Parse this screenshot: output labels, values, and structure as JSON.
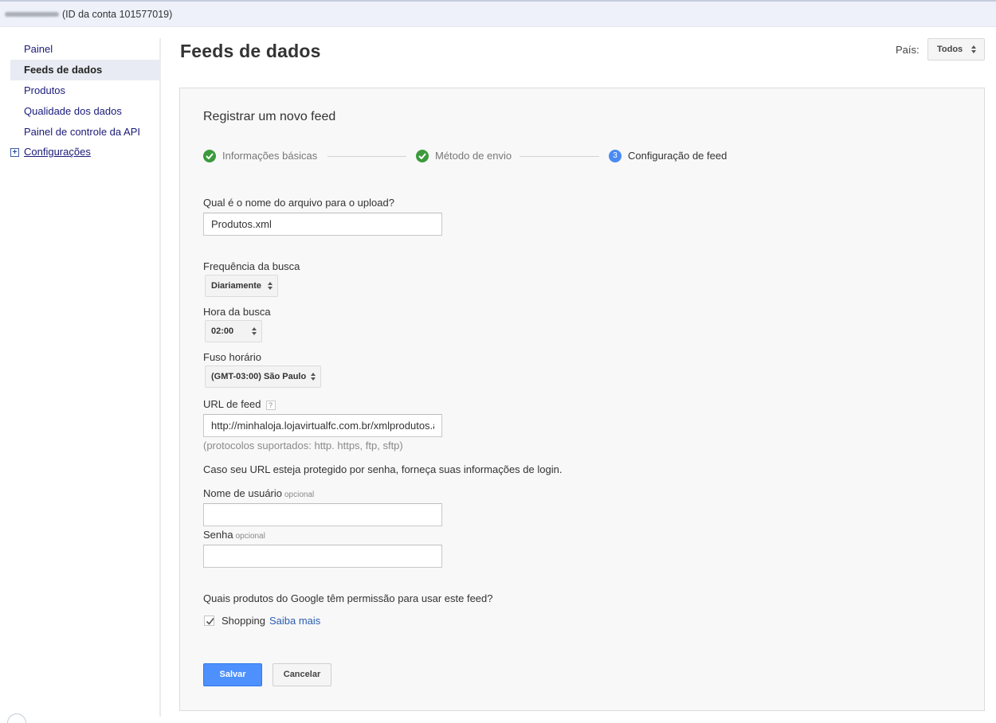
{
  "topbar": {
    "account_id_text": "(ID da conta 101577019)"
  },
  "sidebar": {
    "items": [
      {
        "label": "Painel"
      },
      {
        "label": "Feeds de dados"
      },
      {
        "label": "Produtos"
      },
      {
        "label": "Qualidade dos dados"
      },
      {
        "label": "Painel de controle da API"
      }
    ],
    "config_label": "Configurações",
    "config_icon": "+"
  },
  "header": {
    "title": "Feeds de dados",
    "country_label": "País:",
    "country_value": "Todos"
  },
  "panel": {
    "title": "Registrar um novo feed",
    "steps": [
      {
        "label": "Informações básicas",
        "status": "done",
        "icon": "check-icon"
      },
      {
        "label": "Método de envio",
        "status": "done",
        "icon": "check-icon"
      },
      {
        "label": "Configuração de feed",
        "status": "current",
        "number": "3"
      }
    ]
  },
  "form": {
    "filename_label": "Qual é o nome do arquivo para o upload?",
    "filename_value": "Produtos.xml",
    "frequency_label": "Frequência da busca",
    "frequency_value": "Diariamente",
    "time_label": "Hora da busca",
    "time_value": "02:00",
    "timezone_label": "Fuso horário",
    "timezone_value": "(GMT-03:00) São Paulo",
    "url_label": "URL de feed",
    "url_help": "?",
    "url_value": "http://minhaloja.lojavirtualfc.com.br/xmlprodutos.aspx",
    "protocols_hint": "(protocolos suportados: http. https, ftp, sftp)",
    "login_note": "Caso seu URL esteja protegido por senha, forneça suas informações de login.",
    "username_label": "Nome de usuário",
    "username_optional": "opcional",
    "username_value": "",
    "password_label": "Senha",
    "password_optional": "opcional",
    "password_value": "",
    "products_question": "Quais produtos do Google têm permissão para usar este feed?",
    "shopping_label": "Shopping",
    "shopping_checked": true,
    "learn_more": "Saiba mais"
  },
  "buttons": {
    "save": "Salvar",
    "cancel": "Cancelar"
  },
  "colors": {
    "accent": "#4d90fe",
    "check_green": "#3c9a3c",
    "link": "#2a5db0"
  }
}
